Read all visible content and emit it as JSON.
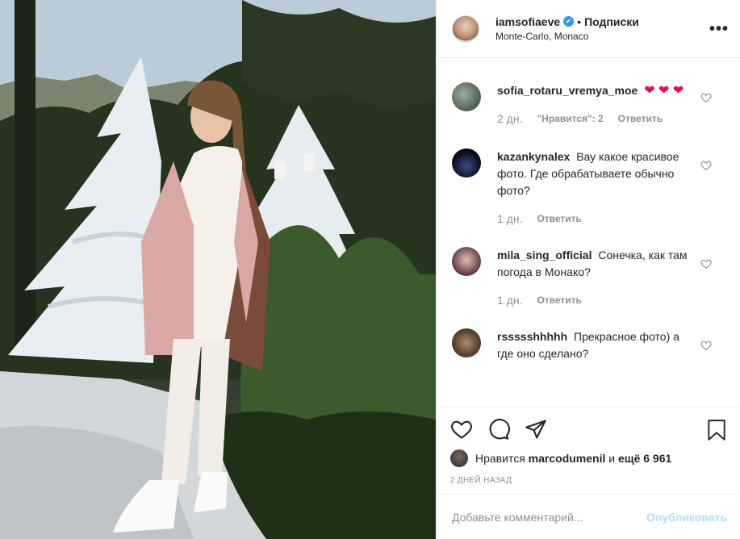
{
  "post": {
    "username": "iamsofiaeve",
    "verified_mark": "✔",
    "separator": "•",
    "follow_label": "Подписки",
    "location": "Monte-Carlo, Monaco",
    "more_icon": "more-options-icon",
    "more_glyph": "•••"
  },
  "comments": [
    {
      "username": "sofia_rotaru_vremya_moe",
      "text": "",
      "emoji": "❤ ❤ ❤",
      "date": "2 дн.",
      "likes": "\"Нравится\": 2",
      "reply": "Ответить"
    },
    {
      "username": "kazankynalex",
      "text": "Вау какое красивое фото. Где обрабатываете обычно фото?",
      "date": "1 дн.",
      "reply": "Ответить"
    },
    {
      "username": "mila_sing_official",
      "text": "Сонечка, как там погода в Монако?",
      "date": "1 дн.",
      "reply": "Ответить"
    },
    {
      "username": "rssssshhhhh",
      "text": "Прекрасное фото) а где оно сделано?"
    }
  ],
  "actions": {
    "icons": [
      "heart-icon",
      "comment-icon",
      "share-icon",
      "bookmark-icon"
    ],
    "likes_prefix": "Нравится",
    "likes_user": "marcodumenil",
    "likes_and": "и",
    "likes_rest": "ещё 6 961",
    "posted": "2 ДНЕЙ НАЗАД"
  },
  "composer": {
    "placeholder": "Добавьте комментарий...",
    "publish": "Опубликовать"
  },
  "colors": {
    "accent": "#3897f0",
    "publish_disabled": "#b2dffc",
    "heart_red": "#e0114a",
    "muted": "#8e8e8e"
  }
}
